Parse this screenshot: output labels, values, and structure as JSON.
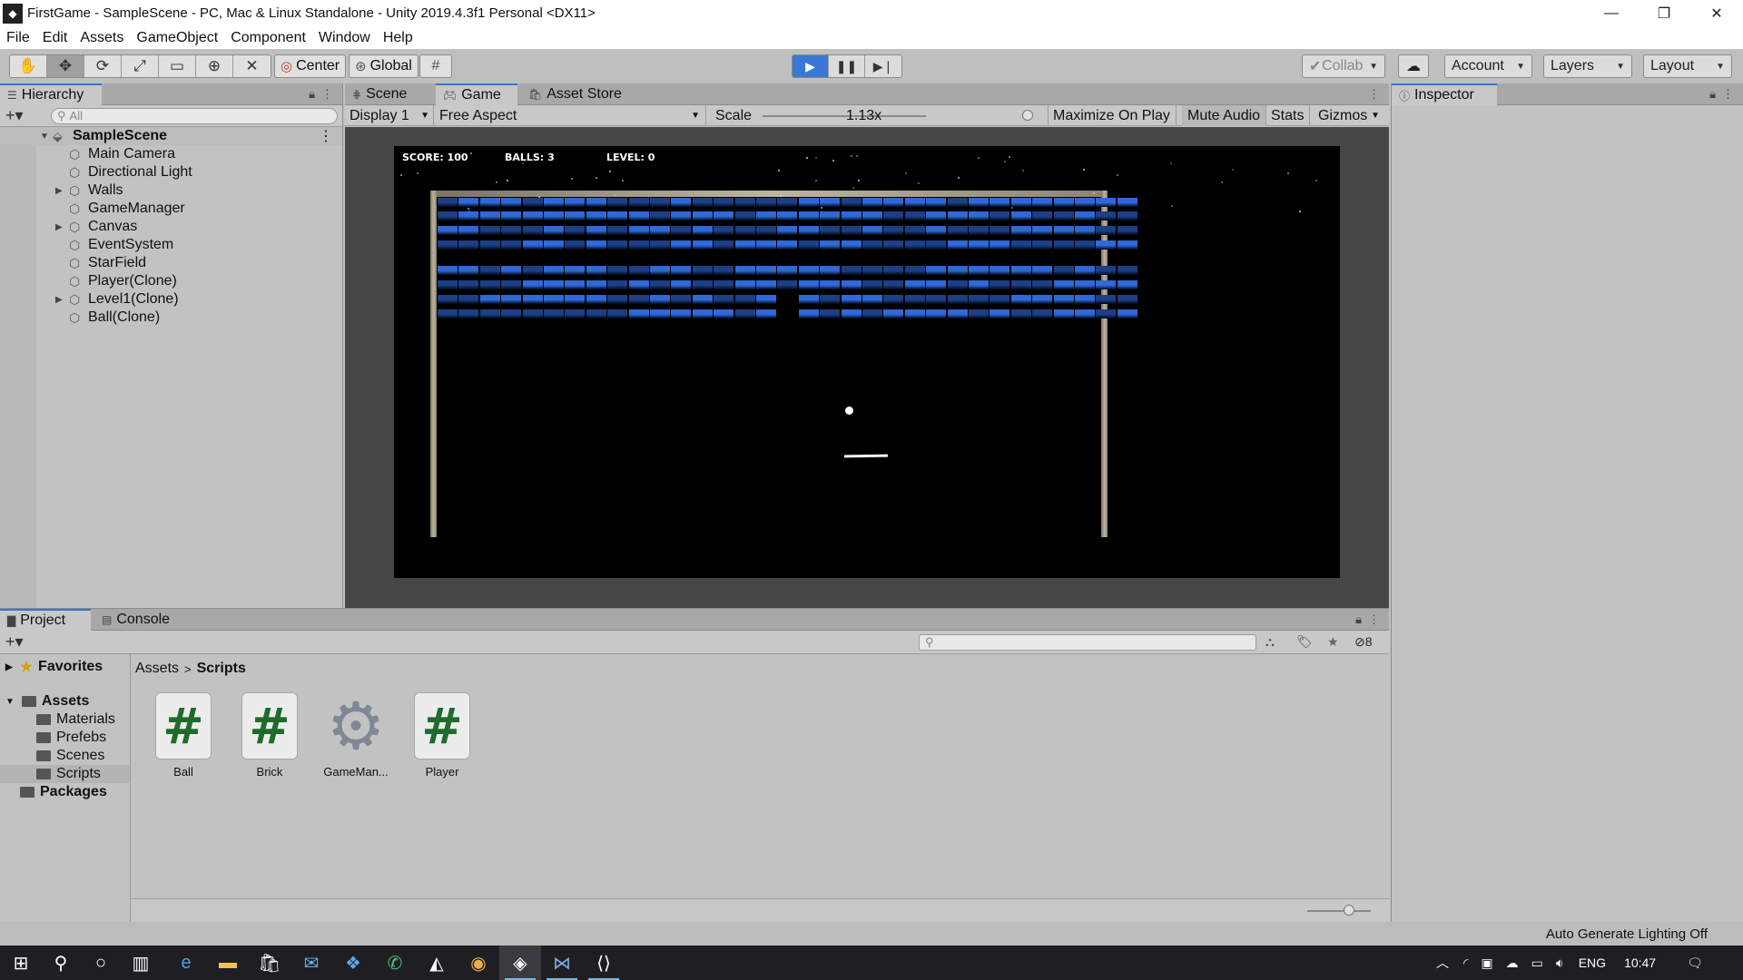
{
  "window": {
    "title": "FirstGame - SampleScene - PC, Mac & Linux Standalone - Unity 2019.4.3f1 Personal <DX11>",
    "controls": {
      "minimize": "—",
      "restore": "❐",
      "close": "✕"
    }
  },
  "menu": [
    "File",
    "Edit",
    "Assets",
    "GameObject",
    "Component",
    "Window",
    "Help"
  ],
  "toolbar": {
    "tools": [
      "hand-icon",
      "move-icon",
      "rotate-icon",
      "scale-icon",
      "rect-icon",
      "transform-icon",
      "custom-tool-icon"
    ],
    "pivot_label": "Center",
    "space_label": "Global",
    "collab_label": "Collab",
    "account_label": "Account",
    "layers_label": "Layers",
    "layout_label": "Layout",
    "play_active": true
  },
  "hierarchy": {
    "tab": "Hierarchy",
    "search_placeholder": "All",
    "scene": "SampleScene",
    "items": [
      {
        "label": "Main Camera",
        "expandable": false
      },
      {
        "label": "Directional Light",
        "expandable": false
      },
      {
        "label": "Walls",
        "expandable": true
      },
      {
        "label": "GameManager",
        "expandable": false
      },
      {
        "label": "Canvas",
        "expandable": true
      },
      {
        "label": "EventSystem",
        "expandable": false
      },
      {
        "label": "StarField",
        "expandable": false
      },
      {
        "label": "Player(Clone)",
        "expandable": false
      },
      {
        "label": "Level1(Clone)",
        "expandable": true
      },
      {
        "label": "Ball(Clone)",
        "expandable": false
      }
    ]
  },
  "gameview": {
    "tabs": [
      "Scene",
      "Game",
      "Asset Store"
    ],
    "active_tab": "Game",
    "display": "Display 1",
    "aspect": "Free Aspect",
    "scale_label": "Scale",
    "scale_value": "1.13x",
    "maximize_label": "Maximize On Play",
    "mute_label": "Mute Audio",
    "stats_label": "Stats",
    "gizmos_label": "Gizmos",
    "hud": {
      "score": "SCORE: 100",
      "balls": "BALLS: 3",
      "level": "LEVEL: 0"
    }
  },
  "inspector": {
    "tab": "Inspector"
  },
  "project": {
    "tabs": [
      "Project",
      "Console"
    ],
    "hidden_count": "8",
    "favorites": "Favorites",
    "assets_root": "Assets",
    "folders": [
      "Materials",
      "Prefebs",
      "Scenes",
      "Scripts"
    ],
    "packages": "Packages",
    "breadcrumb": [
      "Assets",
      "Scripts"
    ],
    "files": [
      {
        "name": "Ball",
        "kind": "script"
      },
      {
        "name": "Brick",
        "kind": "script"
      },
      {
        "name": "GameMan...",
        "kind": "gear"
      },
      {
        "name": "Player",
        "kind": "script"
      }
    ]
  },
  "status": {
    "text": "Auto Generate Lighting Off"
  },
  "taskbar": {
    "lang": "ENG",
    "time": "10:47"
  },
  "colors": {
    "accent": "#3b78d6",
    "brick_bright": "#2f68d8",
    "brick_dim": "#1d3f86",
    "script_hash": "#1f6b2b"
  }
}
